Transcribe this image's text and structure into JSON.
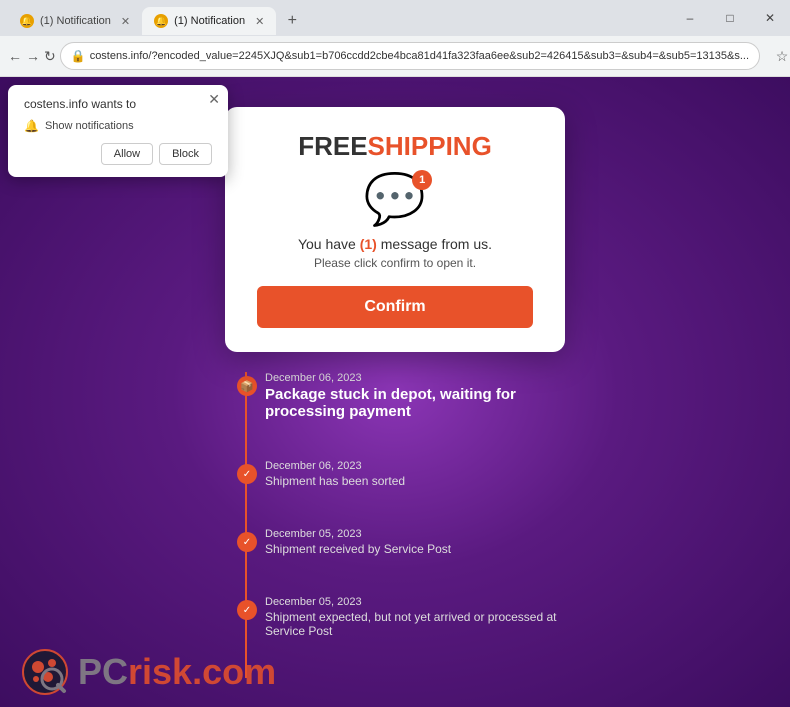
{
  "browser": {
    "tabs": [
      {
        "id": "tab1",
        "title": "(1) Notification",
        "active": false,
        "favicon_color": "#e8a000"
      },
      {
        "id": "tab2",
        "title": "(1) Notification",
        "active": true,
        "favicon_color": "#e8a000"
      }
    ],
    "address": "costens.info/?encoded_value=2245XJQ&sub1=b706ccdd2cbe4bca81d41fa323faa6ee&sub2=426415&sub3=&sub4=&sub5=13135&s...",
    "lock_icon": "🔒"
  },
  "notification_popup": {
    "title": "costens.info wants to",
    "notification_label": "Show notifications",
    "allow_label": "Allow",
    "block_label": "Block"
  },
  "main_card": {
    "free_label": "FREE",
    "shipping_label": "SHIPPING",
    "badge_count": "1",
    "message_text_before": "You have ",
    "message_count": "(1)",
    "message_text_after": " message from us.",
    "please_text": "Please click confirm to open it.",
    "confirm_label": "Confirm"
  },
  "timeline": {
    "items": [
      {
        "date": "December 06, 2023",
        "title": "Package stuck in depot, waiting for processing payment",
        "subtitle": "",
        "type": "current",
        "icon": "📦"
      },
      {
        "date": "December 06, 2023",
        "title": "",
        "subtitle": "Shipment has been sorted",
        "type": "done",
        "icon": "✓"
      },
      {
        "date": "December 05, 2023",
        "title": "",
        "subtitle": "Shipment received by Service Post",
        "type": "done",
        "icon": "✓"
      },
      {
        "date": "December 05, 2023",
        "title": "",
        "subtitle": "Shipment expected, but not yet arrived or processed at Service Post",
        "type": "done",
        "icon": "✓"
      }
    ]
  },
  "watermark": {
    "pc_text": "PC",
    "risk_text": "risk.com"
  }
}
